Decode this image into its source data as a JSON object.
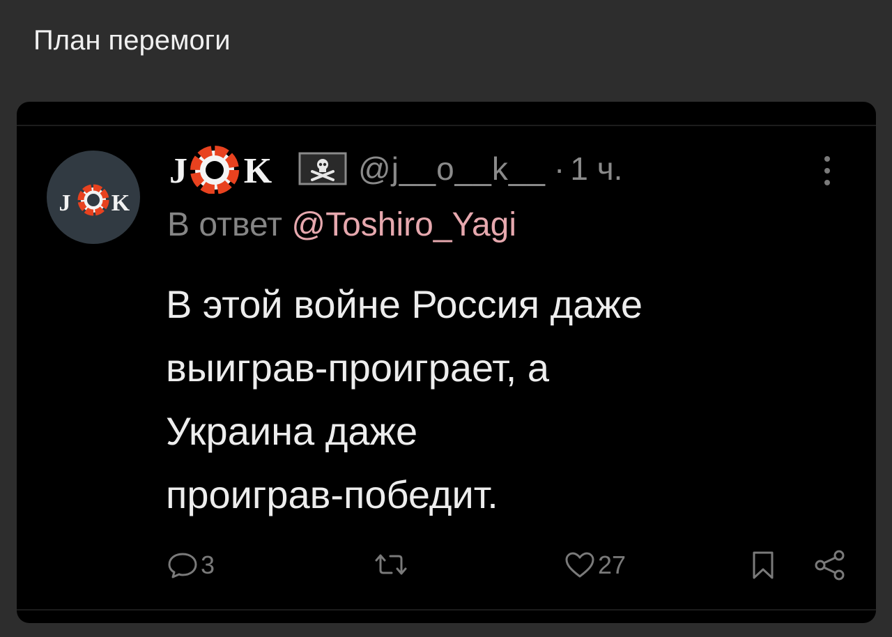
{
  "post": {
    "title": "План перемоги"
  },
  "tweet": {
    "avatar_text": "J K",
    "display_name": "JOK",
    "handle": "@j__o__k__",
    "separator": "·",
    "time": "1 ч.",
    "reply_prefix": "В ответ",
    "reply_to": "@Toshiro_Yagi",
    "text_lines": [
      "В этой войне Россия даже",
      "выиграв-проиграет, а",
      "Украина даже",
      "проиграв-победит."
    ],
    "actions": {
      "reply_icon": "speech-bubble-icon",
      "reply_count": "3",
      "retweet_icon": "retweet-icon",
      "like_icon": "heart-icon",
      "like_count": "27",
      "bookmark_icon": "bookmark-icon",
      "share_icon": "share-icon"
    },
    "flag_icon": "pirate-flag-icon",
    "more_icon": "vertical-ellipsis-icon"
  },
  "colors": {
    "page_background": "#2d2d2d",
    "card_background": "#000000",
    "lifebuoy_orange": "#e8421f",
    "mention_pink": "#e6a8ae",
    "muted_gray": "#858585",
    "text_white": "#ededed"
  }
}
